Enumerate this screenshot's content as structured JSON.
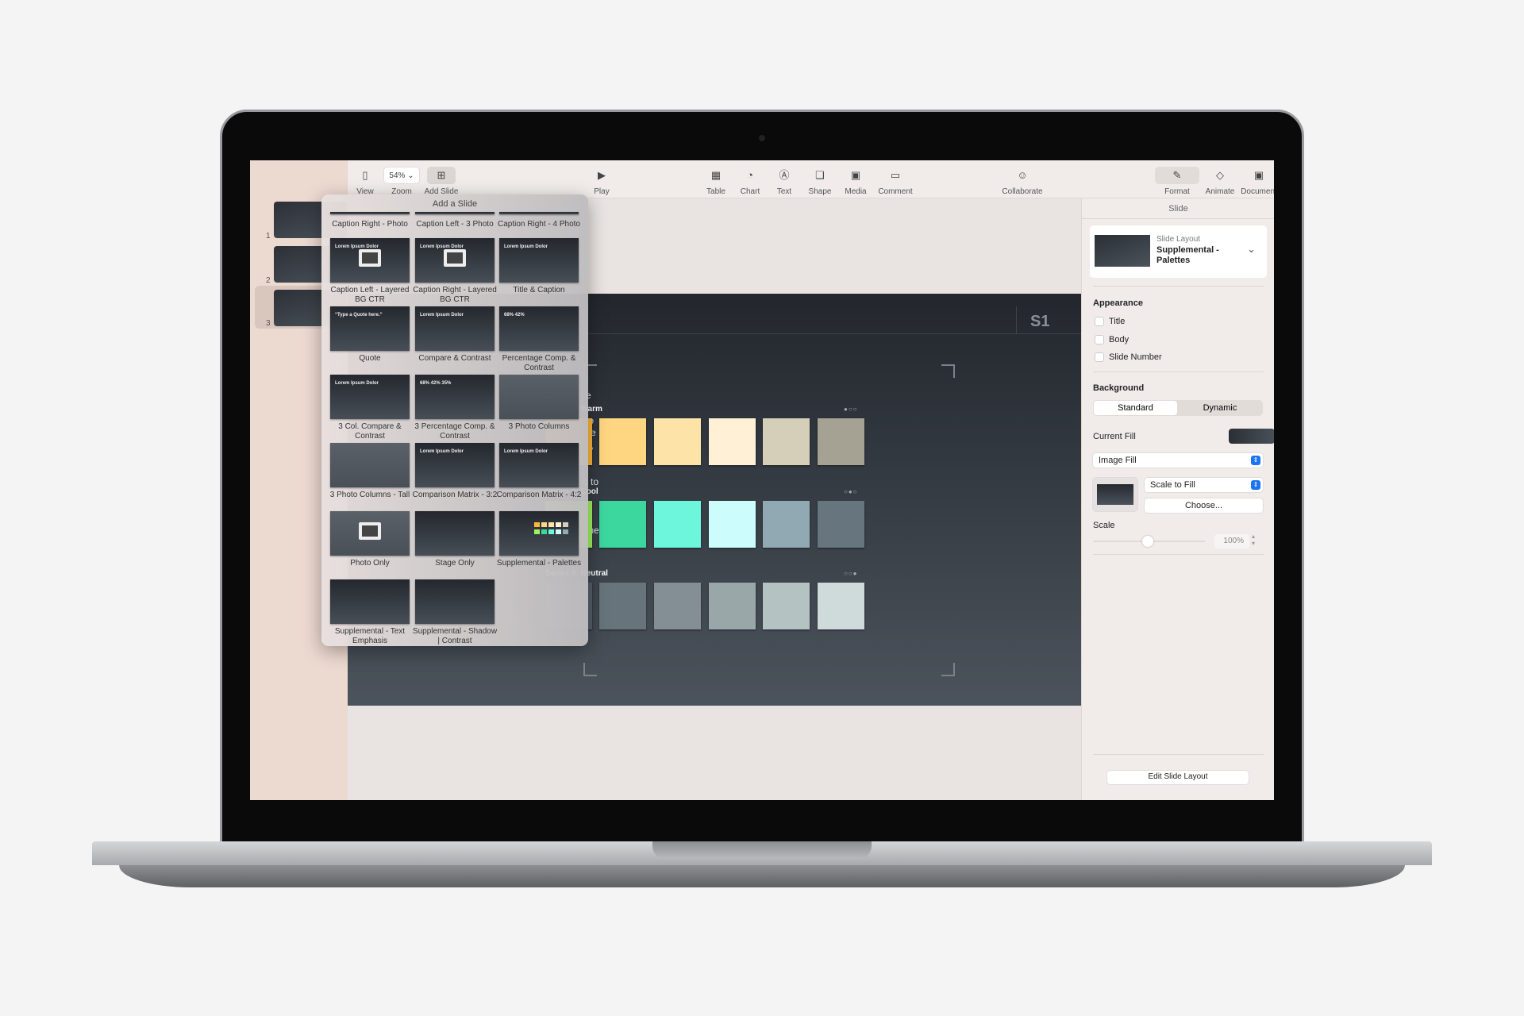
{
  "toolbar": {
    "items": [
      {
        "label": "View",
        "icon": "sidebar-icon"
      },
      {
        "label": "Zoom",
        "value": "54%",
        "icon": "chevron-down-icon"
      },
      {
        "label": "Add Slide",
        "icon": "plus-square-icon"
      },
      {
        "label": "Play",
        "icon": "play-icon"
      },
      {
        "label": "Table",
        "icon": "table-icon"
      },
      {
        "label": "Chart",
        "icon": "chart-icon"
      },
      {
        "label": "Text",
        "icon": "text-icon"
      },
      {
        "label": "Shape",
        "icon": "shape-icon"
      },
      {
        "label": "Media",
        "icon": "media-icon"
      },
      {
        "label": "Comment",
        "icon": "comment-icon"
      },
      {
        "label": "Collaborate",
        "icon": "collaborate-icon"
      },
      {
        "label": "Format",
        "icon": "paintbrush-icon"
      },
      {
        "label": "Animate",
        "icon": "diamond-icon"
      },
      {
        "label": "Document",
        "icon": "document-icon"
      }
    ]
  },
  "navigator": {
    "slides": [
      "1",
      "2",
      "3"
    ],
    "selected": "3"
  },
  "popup": {
    "title": "Add a Slide",
    "layouts": [
      {
        "label": "Caption Right - Photo"
      },
      {
        "label": "Caption Left - 3 Photo"
      },
      {
        "label": "Caption Right - 4 Photo"
      },
      {
        "label": "Caption Left - Layered BG CTR",
        "thumb_text": "Lorem Ipsum Dolor"
      },
      {
        "label": "Caption Right - Layered BG CTR",
        "thumb_text": "Lorem Ipsum Dolor"
      },
      {
        "label": "Title & Caption",
        "thumb_text": "Lorem Ipsum Dolor"
      },
      {
        "label": "Quote",
        "thumb_text": "“Type a Quote here.”"
      },
      {
        "label": "Compare & Contrast",
        "thumb_text": "Lorem Ipsum Dolor"
      },
      {
        "label": "Percentage Comp. & Contrast",
        "thumb_text": "68%   42%"
      },
      {
        "label": "3 Col. Compare & Contrast",
        "thumb_text": "Lorem Ipsum Dolor"
      },
      {
        "label": "3 Percentage Comp. & Contrast",
        "thumb_text": "68%  42%  35%"
      },
      {
        "label": "3 Photo Columns"
      },
      {
        "label": "3 Photo Columns - Tall"
      },
      {
        "label": "Comparison Matrix - 3:2",
        "thumb_text": "Lorem Ipsum Dolor"
      },
      {
        "label": "Comparison Matrix - 4:2",
        "thumb_text": "Lorem Ipsum Dolor"
      },
      {
        "label": "Photo Only"
      },
      {
        "label": "Stage Only"
      },
      {
        "label": "Supplemental - Palettes"
      },
      {
        "label": "Supplemental - Text Emphasis"
      },
      {
        "label": "Supplemental - Shadow | Contrast"
      }
    ]
  },
  "slide": {
    "number": "S1",
    "text_fragments": [
      "e",
      "to",
      "se",
      "n,",
      "e to",
      "the",
      "r"
    ],
    "series": [
      {
        "label": "Series 1: Warm",
        "dots": "●○○",
        "colors": [
          "#fdb63b",
          "#fed580",
          "#fee3a8",
          "#fff0d6",
          "#d5ceb9",
          "#a6a293"
        ]
      },
      {
        "label": "Series 2: Cool",
        "dots": "○●○",
        "colors": [
          "#9ef35c",
          "#3cd79f",
          "#6ef6dc",
          "#ccfdfc",
          "#91a9b3",
          "#67767e"
        ]
      },
      {
        "label": "Series 3: Neutral",
        "dots": "○○●",
        "colors": [
          "#535f67",
          "#67747b",
          "#838f95",
          "#9aa7a8",
          "#b5c2c2",
          "#cfdadb"
        ]
      }
    ]
  },
  "panel": {
    "tab": "Slide",
    "layout_caption": "Slide Layout",
    "layout_name": "Supplemental - Palettes",
    "appearance": {
      "heading": "Appearance",
      "options": [
        {
          "label": "Title",
          "checked": false
        },
        {
          "label": "Body",
          "checked": false
        },
        {
          "label": "Slide Number",
          "checked": false
        }
      ]
    },
    "background": {
      "heading": "Background",
      "segments": [
        "Standard",
        "Dynamic"
      ],
      "selected": "Standard"
    },
    "current_fill": "Current Fill",
    "fill_type": "Image Fill",
    "scale_mode": "Scale to Fill",
    "choose": "Choose...",
    "scale_label": "Scale",
    "scale_value": "100%",
    "edit_button": "Edit Slide Layout"
  }
}
